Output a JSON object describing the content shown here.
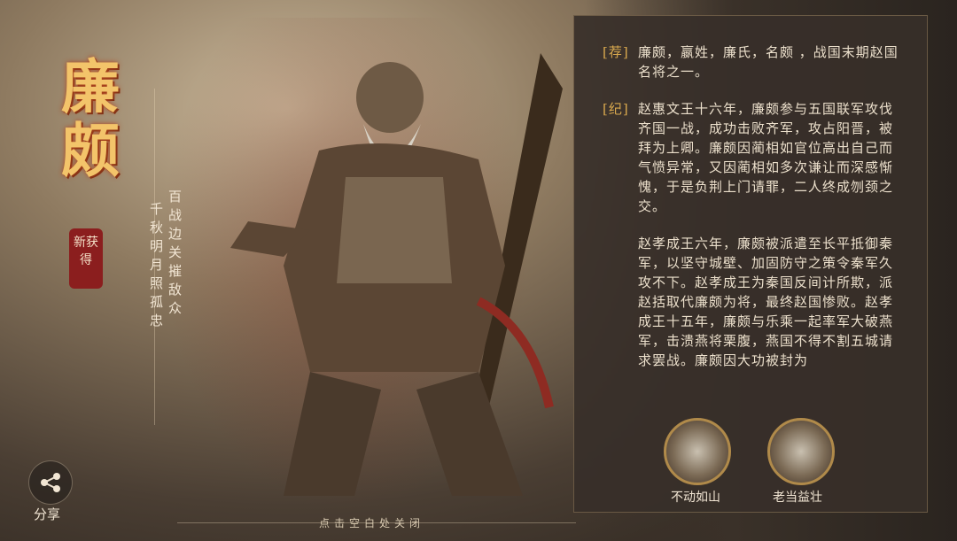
{
  "hero": {
    "name": "廉颇",
    "badge": "新获得",
    "poem_line1": "百战边关摧敌众",
    "poem_line2": "千秋明月照孤忠"
  },
  "share": {
    "label": "分享"
  },
  "bio": {
    "p1_tag": "[荐]",
    "p1_text": "廉颇，嬴姓，廉氏，名颇 ，战国末期赵国名将之一。",
    "p2_tag": "[纪]",
    "p2_text": "赵惠文王十六年，廉颇参与五国联军攻伐齐国一战，成功击败齐军，攻占阳晋，被拜为上卿。廉颇因蔺相如官位高出自己而气愤异常，又因蔺相如多次谦让而深感惭愧，于是负荆上门请罪，二人终成刎颈之交。",
    "p3_text": "赵孝成王六年，廉颇被派遣至长平抵御秦军，以坚守城壁、加固防守之策令秦军久攻不下。赵孝成王为秦国反间计所欺，派赵括取代廉颇为将，最终赵国惨败。赵孝成王十五年，廉颇与乐乘一起率军大破燕军，击溃燕将栗腹，燕国不得不割五城请求罢战。廉颇因大功被封为"
  },
  "skills": [
    {
      "label": "不动如山"
    },
    {
      "label": "老当益壮"
    }
  ],
  "footer": {
    "close_hint": "点击空白处关闭"
  },
  "colors": {
    "accent": "#d9a94e",
    "name": "#f3c46a",
    "stamp": "#8b1e1e"
  }
}
